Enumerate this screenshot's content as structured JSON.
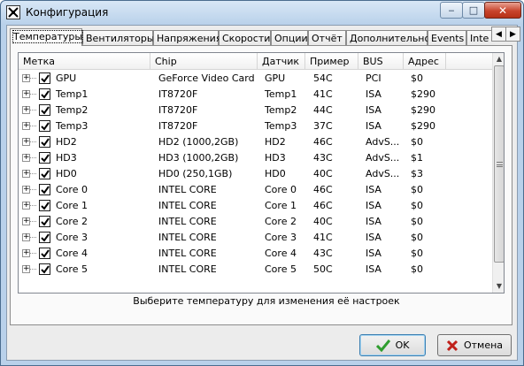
{
  "window": {
    "title": "Конфигурация",
    "minimize_symbol": "‒",
    "maximize_symbol": "□",
    "close_symbol": "✕"
  },
  "tabs": [
    {
      "label": "Температуры",
      "active": true
    },
    {
      "label": "Вентиляторы",
      "active": false
    },
    {
      "label": "Напряжения",
      "active": false
    },
    {
      "label": "Скорости",
      "active": false
    },
    {
      "label": "Опции",
      "active": false
    },
    {
      "label": "Отчёт",
      "active": false
    },
    {
      "label": "Дополнительно",
      "active": false
    },
    {
      "label": "Events",
      "active": false
    },
    {
      "label": "Inte",
      "active": false
    }
  ],
  "tab_scroll": {
    "left": "◀",
    "right": "▶"
  },
  "table": {
    "columns": [
      "Метка",
      "Chip",
      "Датчик",
      "Пример",
      "BUS",
      "Адрес"
    ],
    "rows": [
      {
        "label": "GPU",
        "chip": "GeForce Video Card",
        "sensor": "GPU",
        "example": "54C",
        "bus": "PCI",
        "address": "$0",
        "checked": true
      },
      {
        "label": "Temp1",
        "chip": "IT8720F",
        "sensor": "Temp1",
        "example": "41C",
        "bus": "ISA",
        "address": "$290",
        "checked": true
      },
      {
        "label": "Temp2",
        "chip": "IT8720F",
        "sensor": "Temp2",
        "example": "44C",
        "bus": "ISA",
        "address": "$290",
        "checked": true
      },
      {
        "label": "Temp3",
        "chip": "IT8720F",
        "sensor": "Temp3",
        "example": "37C",
        "bus": "ISA",
        "address": "$290",
        "checked": true
      },
      {
        "label": "HD2",
        "chip": "HD2 (1000,2GB)",
        "sensor": "HD2",
        "example": "46C",
        "bus": "AdvS...",
        "address": "$0",
        "checked": true
      },
      {
        "label": "HD3",
        "chip": "HD3 (1000,2GB)",
        "sensor": "HD3",
        "example": "43C",
        "bus": "AdvS...",
        "address": "$1",
        "checked": true
      },
      {
        "label": "HD0",
        "chip": "HD0 (250,1GB)",
        "sensor": "HD0",
        "example": "40C",
        "bus": "AdvS...",
        "address": "$3",
        "checked": true
      },
      {
        "label": "Core 0",
        "chip": "INTEL CORE",
        "sensor": "Core 0",
        "example": "46C",
        "bus": "ISA",
        "address": "$0",
        "checked": true
      },
      {
        "label": "Core 1",
        "chip": "INTEL CORE",
        "sensor": "Core 1",
        "example": "46C",
        "bus": "ISA",
        "address": "$0",
        "checked": true
      },
      {
        "label": "Core 2",
        "chip": "INTEL CORE",
        "sensor": "Core 2",
        "example": "40C",
        "bus": "ISA",
        "address": "$0",
        "checked": true
      },
      {
        "label": "Core 3",
        "chip": "INTEL CORE",
        "sensor": "Core 3",
        "example": "41C",
        "bus": "ISA",
        "address": "$0",
        "checked": true
      },
      {
        "label": "Core 4",
        "chip": "INTEL CORE",
        "sensor": "Core 4",
        "example": "43C",
        "bus": "ISA",
        "address": "$0",
        "checked": true
      },
      {
        "label": "Core 5",
        "chip": "INTEL CORE",
        "sensor": "Core 5",
        "example": "50C",
        "bus": "ISA",
        "address": "$0",
        "checked": true
      }
    ],
    "expander_symbol": "+",
    "scroll_up": "▲",
    "scroll_down": "▼"
  },
  "hint": "Выберите температуру для изменения её настроек",
  "buttons": {
    "ok": "OK",
    "cancel": "Отмена"
  },
  "colors": {
    "ok_icon": "#2e9d2e",
    "cancel_icon": "#c0201a"
  }
}
